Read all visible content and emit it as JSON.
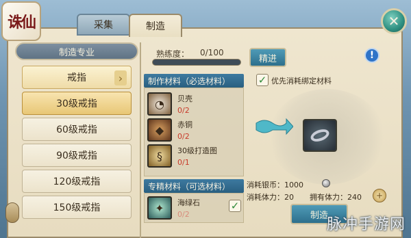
{
  "app": {
    "logo_text": "诛仙"
  },
  "tabs": [
    {
      "label": "采集",
      "active": false
    },
    {
      "label": "制造",
      "active": true
    }
  ],
  "close_icon": "close-icon",
  "left_panel": {
    "header": "制造专业",
    "items": [
      {
        "label": "戒指",
        "type": "parent"
      },
      {
        "label": "30级戒指",
        "type": "selected"
      },
      {
        "label": "60级戒指",
        "type": "normal"
      },
      {
        "label": "90级戒指",
        "type": "normal"
      },
      {
        "label": "120级戒指",
        "type": "normal"
      },
      {
        "label": "150级戒指",
        "type": "normal"
      }
    ]
  },
  "proficiency": {
    "label": "熟练度：",
    "value": "0/100",
    "progress": 0
  },
  "refine_button": "精进",
  "prefer_bound": {
    "label": "优先消耗绑定材料",
    "checked": true
  },
  "required_materials": {
    "header": "制作材料（必选材料）",
    "items": [
      {
        "name": "贝壳",
        "count": "0/2",
        "icon": "shell-icon"
      },
      {
        "name": "赤铜",
        "count": "0/2",
        "icon": "copper-icon"
      },
      {
        "name": "30级打造图",
        "count": "0/1",
        "icon": "scroll-icon"
      }
    ]
  },
  "special_materials": {
    "header": "专精材料（可选材料）",
    "items": [
      {
        "name": "海绿石",
        "count": "0/2",
        "icon": "gem-icon",
        "checked": true
      }
    ]
  },
  "costs": {
    "silver": "消耗银币：1000",
    "stamina": "消耗体力：20",
    "owned_stamina": "拥有体力：240"
  },
  "craft_button": "制造",
  "watermark": "脉冲手游网",
  "colors": {
    "accent_blue": "#2d6f8c",
    "parchment": "#efe6cf",
    "warn_red": "#c83a2a"
  }
}
